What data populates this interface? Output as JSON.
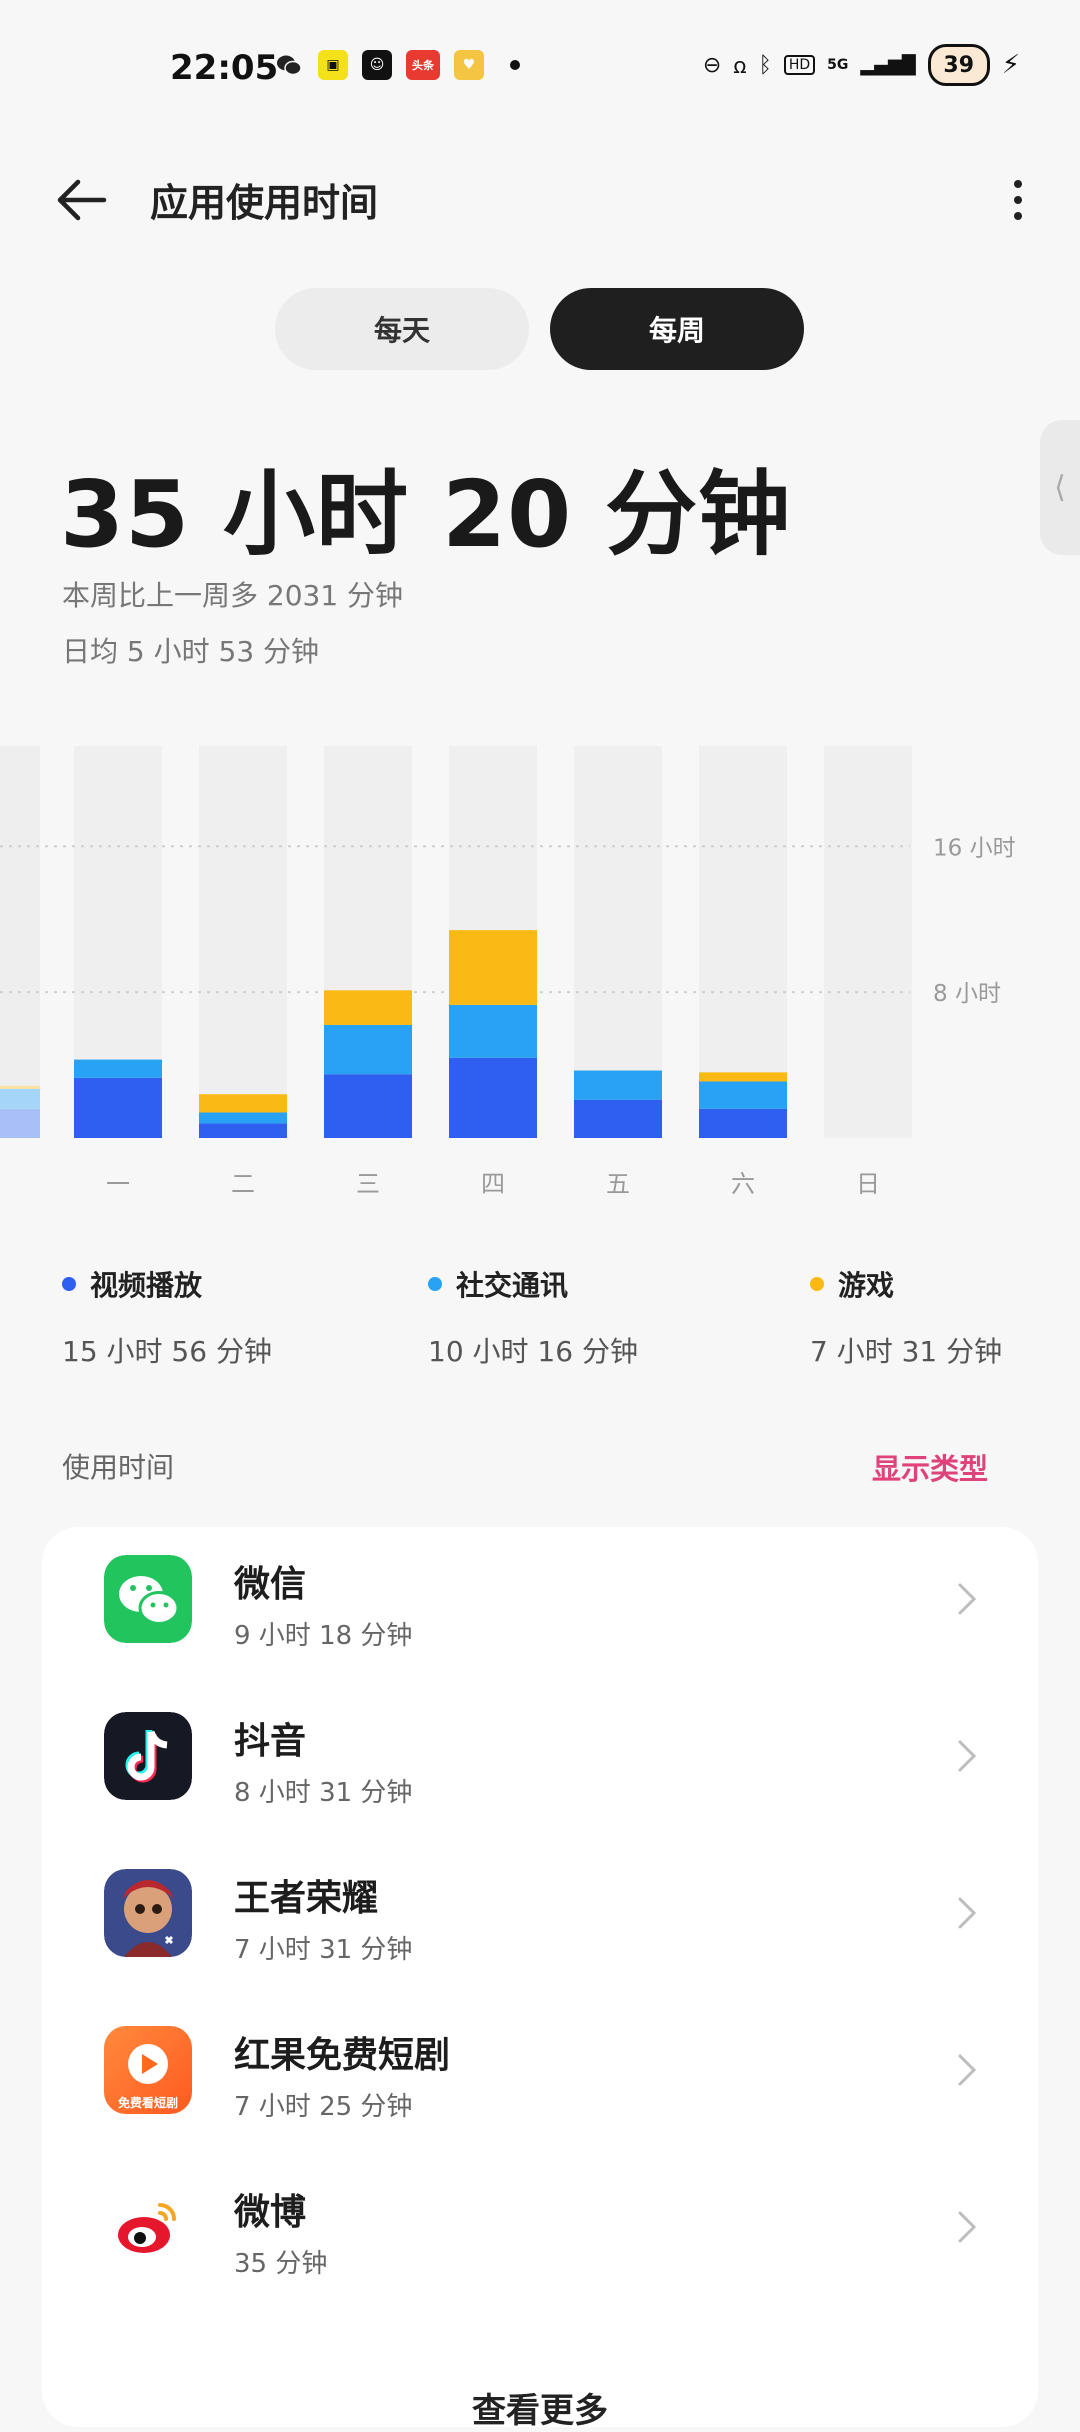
{
  "status_bar": {
    "time": "22:05",
    "notification_icons": [
      "wechat-icon",
      "app-badge-icon",
      "app-smile-icon",
      "toutiao-icon",
      "heart-app-icon"
    ],
    "toutiao_text": "头条",
    "network": "5G",
    "battery": "39"
  },
  "header": {
    "title": "应用使用时间"
  },
  "tabs": [
    {
      "label": "每天",
      "selected": false
    },
    {
      "label": "每周",
      "selected": true
    }
  ],
  "summary": {
    "total": "35 小时 20 分钟",
    "compare": "本周比上一周多 2031 分钟",
    "average": "日均 5 小时 53 分钟"
  },
  "chart_data": {
    "type": "bar",
    "stacked": true,
    "categories": [
      "一",
      "二",
      "三",
      "四",
      "五",
      "六",
      "日"
    ],
    "y_unit": "小时",
    "ylim": [
      0,
      21.5
    ],
    "y_ticks": [
      {
        "value": 8,
        "label": "8 小时"
      },
      {
        "value": 16,
        "label": "16 小时"
      }
    ],
    "grid": true,
    "partial_previous_week_bar": true,
    "series": [
      {
        "name": "视频播放",
        "color": "#2f5ff0",
        "values": [
          3.3,
          0.8,
          3.5,
          4.4,
          2.1,
          1.6,
          0
        ]
      },
      {
        "name": "社交通讯",
        "color": "#27a2f5",
        "values": [
          1.0,
          0.6,
          2.7,
          2.9,
          1.6,
          1.5,
          0
        ]
      },
      {
        "name": "游戏",
        "color": "#fbb915",
        "values": [
          0,
          1.0,
          1.9,
          4.1,
          0,
          0.5,
          0
        ]
      }
    ]
  },
  "legend": [
    {
      "name": "视频播放",
      "total": "15 小时 56 分钟",
      "color": "#2f5ff0"
    },
    {
      "name": "社交通讯",
      "total": "10 小时 16 分钟",
      "color": "#27a2f5"
    },
    {
      "name": "游戏",
      "total": "7 小时 31 分钟",
      "color": "#fbb915"
    }
  ],
  "usage_section": {
    "label": "使用时间",
    "action": "显示类型"
  },
  "apps": [
    {
      "name": "微信",
      "time": "9 小时 18 分钟",
      "icon": "wechat-icon"
    },
    {
      "name": "抖音",
      "time": "8 小时 31 分钟",
      "icon": "douyin-icon"
    },
    {
      "name": "王者荣耀",
      "time": "7 小时 31 分钟",
      "icon": "honor-of-kings-icon"
    },
    {
      "name": "红果免费短剧",
      "time": "7 小时 25 分钟",
      "icon": "hongguo-icon",
      "icon_text": "免费看短剧"
    },
    {
      "name": "微博",
      "time": "35 分钟",
      "icon": "weibo-icon"
    }
  ],
  "bottom_peek": "查看更多"
}
